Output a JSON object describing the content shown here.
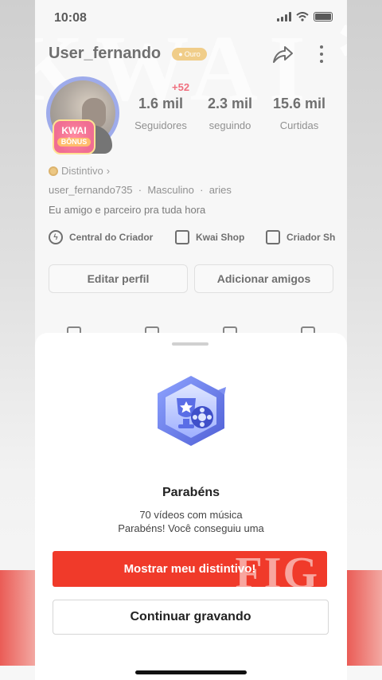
{
  "status_bar": {
    "time": "10:08"
  },
  "profile": {
    "username": "User_fernando",
    "tier_badge": "Ouro",
    "new_followers": "+52",
    "kwai_bonus": {
      "line1": "KWAI",
      "line2": "BÔNUS"
    },
    "stats": [
      {
        "value": "1.6 mil",
        "label": "Seguidores"
      },
      {
        "value": "2.3 mil",
        "label": "seguindo"
      },
      {
        "value": "15.6 mil",
        "label": "Curtidas"
      }
    ],
    "distintivo_label": "Distintivo",
    "handle": "user_fernando735",
    "gender": "Masculino",
    "sign": "aries",
    "bio": "Eu amigo e parceiro pra tuda hora",
    "quick_links": [
      {
        "label": "Central do Criador",
        "icon": "lightning-icon"
      },
      {
        "label": "Kwai Shop",
        "icon": "shopping-bag-icon"
      },
      {
        "label": "Criador Sh",
        "icon": "store-icon"
      }
    ],
    "edit_profile_label": "Editar perfil",
    "add_friends_label": "Adicionar amigos"
  },
  "sheet": {
    "title": "Parabéns",
    "line1": "70 vídeos com música",
    "line2": "Parabéns! Você conseguiu uma",
    "primary_button": "Mostrar meu distintivo!",
    "secondary_button": "Continuar gravando"
  },
  "colors": {
    "accent_red": "#f03a2a",
    "badge_blue": "#6b7fe0",
    "gold": "#e9b24a"
  }
}
